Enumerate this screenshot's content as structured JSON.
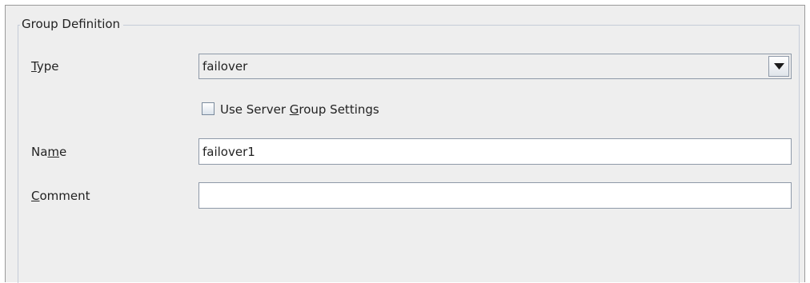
{
  "group": {
    "title": "Group Definition"
  },
  "type_field": {
    "label_mnemonic": "T",
    "label_rest": "ype",
    "value": "failover",
    "dropdown_icon": "triangle-down-icon"
  },
  "server_group": {
    "label_prefix": "Use Server ",
    "label_mnemonic": "G",
    "label_suffix": "roup Settings",
    "checked": false
  },
  "name_field": {
    "label_prefix": "Na",
    "label_mnemonic": "m",
    "label_suffix": "e",
    "value": "failover1"
  },
  "comment_field": {
    "label_mnemonic": "C",
    "label_rest": "omment",
    "value": ""
  },
  "colors": {
    "panel_background": "#eeeeee",
    "field_border": "#8e99a8",
    "group_border": "#c5ccd8"
  }
}
